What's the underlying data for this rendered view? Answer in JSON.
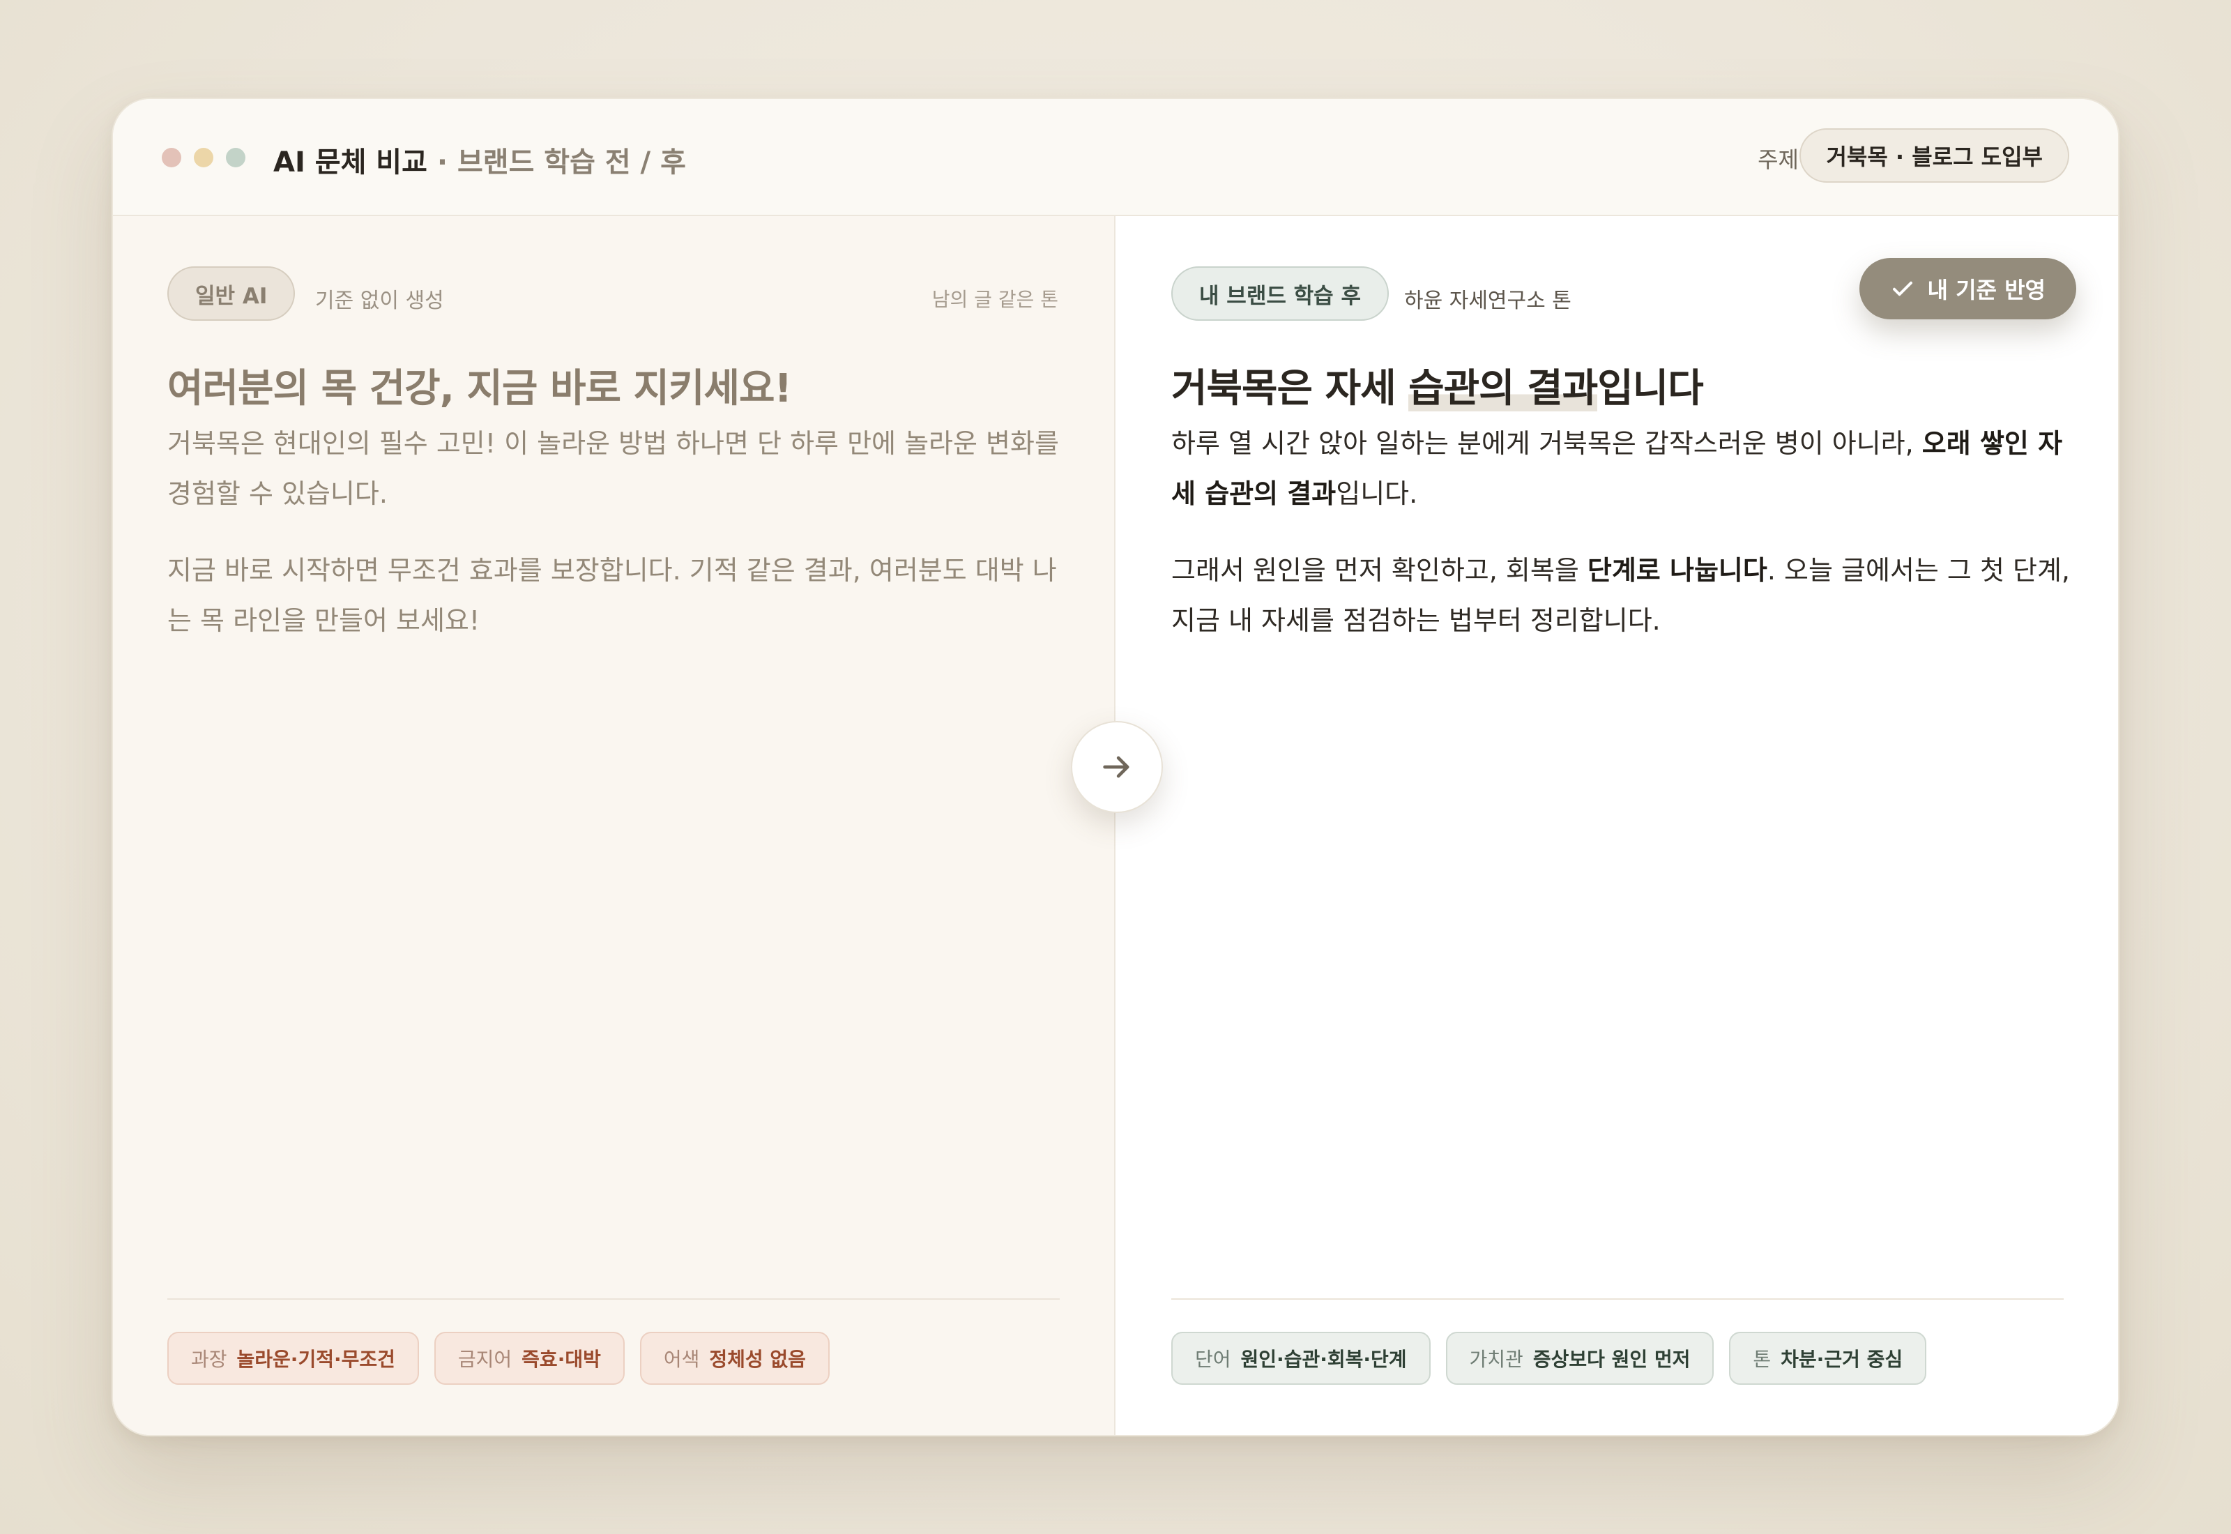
{
  "window": {
    "title": "AI 문체 비교",
    "subtitle": "· 브랜드 학습 전 / 후",
    "topic_label": "주제",
    "topic_value": "거북목 · 블로그 도입부",
    "dot_colors": [
      "#e3c2b8",
      "#ecd6a8",
      "#c3d3c8"
    ]
  },
  "left": {
    "pill": "일반 AI",
    "pill_desc": "기준 없이 생성",
    "tone_tag": "남의 글 같은 톤",
    "headline": "여러분의 목 건강, 지금 바로 지키세요!",
    "p1": "거북목은 현대인의 필수 고민! 이 놀라운 방법 하나면 단 하루 만에 놀라운 변화를 경험할 수 있습니다.",
    "p2": "지금 바로 시작하면 무조건 효과를 보장합니다. 기적 같은 결과, 여러분도 대박 나는 목 라인을 만들어 보세요!",
    "tags": [
      {
        "key": "과장",
        "value": "놀라운·기적·무조건"
      },
      {
        "key": "금지어",
        "value": "즉효·대박"
      },
      {
        "key": "어색",
        "value": "정체성 없음"
      }
    ]
  },
  "right": {
    "pill": "내 브랜드 학습 후",
    "pill_desc": "하윤 자세연구소 톤",
    "apply_button": "내 기준 반영",
    "headline_a": "거북목은 자세 ",
    "headline_hl": "습관의 결과",
    "headline_b": "입니다",
    "p1_a": "하루 열 시간 앉아 일하는 분에게 거북목은 갑작스러운 병이 아니라, ",
    "p1_bold": "오래 쌓인 자세 습관의 결과",
    "p1_b": "입니다.",
    "p2_a": "그래서 원인을 먼저 확인하고, 회복을 ",
    "p2_bold": "단계로 나눕니다",
    "p2_b": ". 오늘 글에서는 그 첫 단계, 지금 내 자세를 점검하는 법부터 정리합니다.",
    "tags": [
      {
        "key": "단어",
        "value": "원인·습관·회복·단계"
      },
      {
        "key": "가치관",
        "value": "증상보다 원인 먼저"
      },
      {
        "key": "톤",
        "value": "차분·근거 중심"
      }
    ]
  },
  "icons": {
    "apply": "check-icon",
    "compare": "arrow-right-icon"
  }
}
